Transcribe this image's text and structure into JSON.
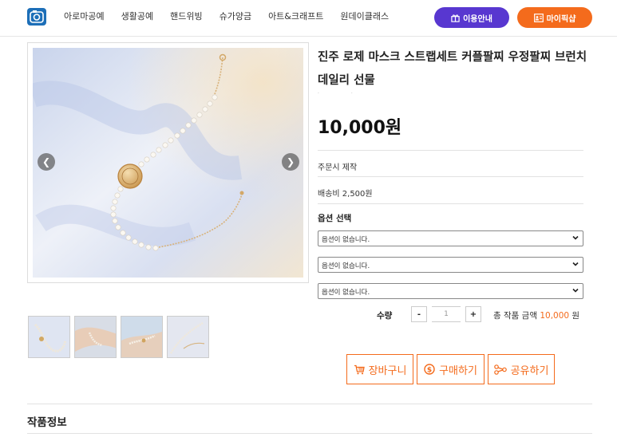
{
  "header": {
    "nav": [
      "아로마공예",
      "생활공예",
      "핸드위빙",
      "슈가양금",
      "아트&크래프트",
      "원데이클래스"
    ],
    "guide_button": "이용안내",
    "mypage_button": "마이픽샵"
  },
  "product": {
    "title": "진주 로제 마스크 스트랩세트 커플팔찌 우정팔찌 브런치 데일리 선물",
    "price": "10,000원",
    "made_to_order": "주문시 제작",
    "shipping": "배송비 2,500원",
    "option_label": "옵션 선택",
    "options": [
      "옵션이 없습니다.",
      "옵션이 없습니다.",
      "옵션이 없습니다."
    ],
    "quantity_label": "수량",
    "quantity": "1",
    "minus": "-",
    "plus": "+",
    "total_prefix": "총 작품 금액",
    "total_amount": "10,000",
    "total_suffix": "원"
  },
  "actions": {
    "cart": "장바구니",
    "buy": "구매하기",
    "share": "공유하기"
  },
  "section": {
    "title": "작품정보"
  },
  "colors": {
    "guide": "#5837d0",
    "accent": "#f46b1c"
  }
}
